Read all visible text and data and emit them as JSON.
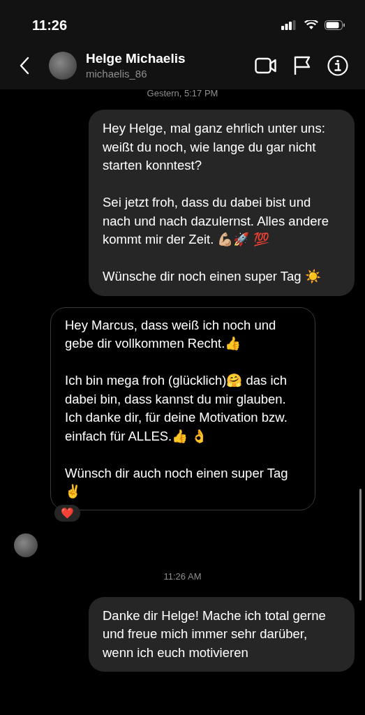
{
  "status_bar": {
    "time": "11:26"
  },
  "header": {
    "name": "Helge Michaelis",
    "username": "michaelis_86"
  },
  "messages": [
    {
      "kind": "timestamp",
      "text": "Gestern, 5:17 PM"
    },
    {
      "kind": "sent",
      "paragraphs": [
        "Hey Helge, mal ganz ehrlich unter uns: weißt du noch, wie lange du gar nicht starten konntest?",
        "Sei jetzt froh, dass du dabei bist und nach und nach dazulernst. Alles andere kommt mir der Zeit. 💪🏼🚀 💯",
        "Wünsche dir noch einen super Tag ☀️"
      ]
    },
    {
      "kind": "received",
      "paragraphs": [
        "Hey Marcus, dass weiß ich noch und gebe dir vollkommen Recht.👍",
        "Ich bin mega froh (glücklich)🤗  das ich dabei bin, dass kannst du mir glauben.\nIch danke dir, für deine Motivation bzw.\neinfach für ALLES.👍 👌",
        "Wünsch dir auch noch einen super Tag✌️"
      ],
      "reaction": "❤️"
    },
    {
      "kind": "timestamp",
      "text": "11:26 AM"
    },
    {
      "kind": "sent",
      "paragraphs": [
        "Danke dir Helge! Mache ich total gerne und freue mich immer sehr darüber, wenn ich euch motivieren"
      ]
    }
  ]
}
